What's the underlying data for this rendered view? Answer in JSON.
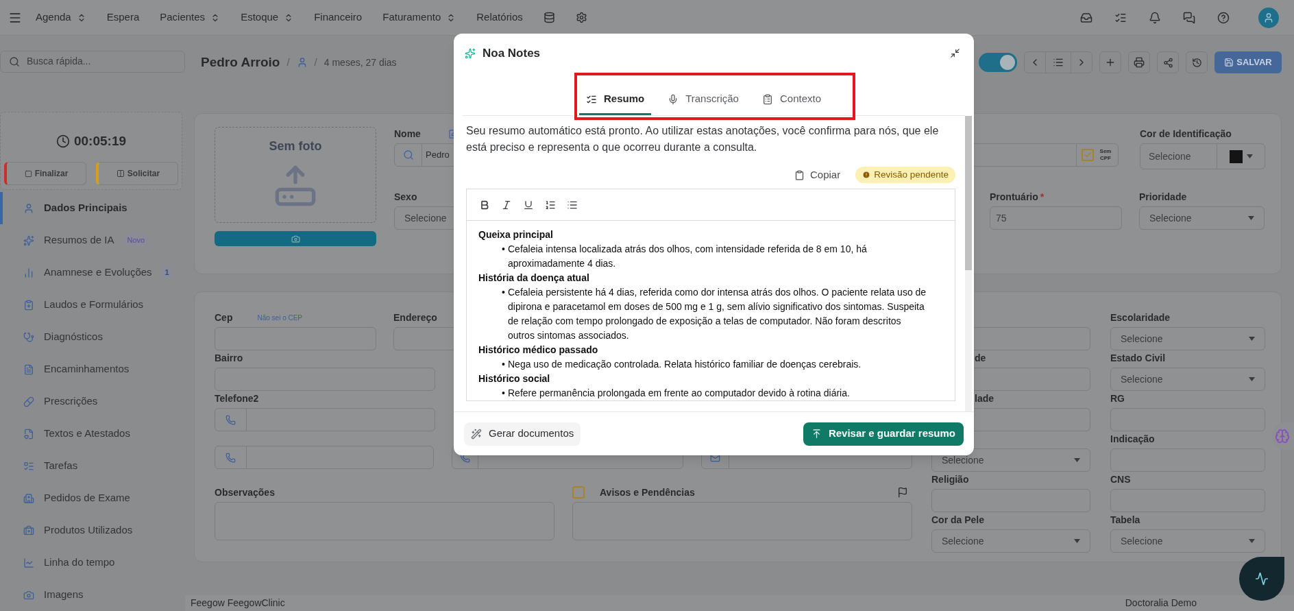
{
  "top_nav": {
    "menu": [
      {
        "label": "Agenda",
        "dropdown": true
      },
      {
        "label": "Espera",
        "dropdown": false
      },
      {
        "label": "Pacientes",
        "dropdown": true
      },
      {
        "label": "Estoque",
        "dropdown": true
      },
      {
        "label": "Financeiro",
        "dropdown": false
      },
      {
        "label": "Faturamento",
        "dropdown": true
      },
      {
        "label": "Relatórios",
        "dropdown": false
      }
    ]
  },
  "sidebar": {
    "search": {
      "placeholder": "Busca rápida..."
    },
    "timer": {
      "time": "00:05:19",
      "buttons": [
        {
          "label": "Finalizar",
          "color": "#c9302c"
        },
        {
          "label": "Solicitar",
          "color": "#d4a017"
        }
      ]
    },
    "items": [
      {
        "label": "Dados Principais",
        "selected": true
      },
      {
        "label": "Resumos de IA",
        "selected": false,
        "badge": "Novo"
      },
      {
        "label": "Anamnese e Evoluções",
        "selected": false,
        "badge": "1"
      },
      {
        "label": "Laudos e Formulários",
        "selected": false
      },
      {
        "label": "Diagnósticos",
        "selected": false
      },
      {
        "label": "Encaminhamentos",
        "selected": false
      },
      {
        "label": "Prescrições",
        "selected": false
      },
      {
        "label": "Textos e Atestados",
        "selected": false
      },
      {
        "label": "Tarefas",
        "selected": false
      },
      {
        "label": "Pedidos de Exame",
        "selected": false
      },
      {
        "label": "Produtos Utilizados",
        "selected": false
      },
      {
        "label": "Linha do tempo",
        "selected": false
      },
      {
        "label": "Imagens",
        "selected": false
      }
    ]
  },
  "header": {
    "patient_name": "Pedro Arroio",
    "separator_1": "/",
    "separator_2": "/",
    "age": "4 meses, 27 dias",
    "toggle": {
      "on": true
    },
    "save_button": "SALVAR"
  },
  "profile_card": {
    "photo_caption": "Sem foto",
    "nome": {
      "label": "Nome",
      "value": "Pedro"
    },
    "sem_cpf": {
      "label": "Sem CPF",
      "checked": true
    },
    "cor_identificacao": {
      "label": "Cor de Identificação",
      "value": "Selecione",
      "color": "#141414"
    },
    "sexo": {
      "label": "Sexo",
      "value": "Selecione"
    },
    "prontuario": {
      "label": "Prontuário",
      "required_mark": "*",
      "value": "75"
    },
    "prioridade": {
      "label": "Prioridade",
      "value": "Selecione"
    }
  },
  "address_card": {
    "cep": {
      "label": "Cep",
      "link": "Não sei o CEP"
    },
    "endereco": {
      "label": "Endereço"
    },
    "bairro": {
      "label": "Bairro"
    },
    "telefone2": {
      "label": "Telefone2"
    },
    "observacoes": {
      "label": "Observações"
    },
    "avisos": {
      "label": "Avisos e Pendências",
      "checked": false
    },
    "right_fields": [
      {
        "kind": "input"
      },
      {
        "kind": "select",
        "label": "Escolaridade",
        "value": "Selecione"
      },
      {
        "kind": "input",
        "label": "de",
        "label_cut": true
      },
      {
        "kind": "select",
        "label": "Estado Civil",
        "value": "Selecione"
      },
      {
        "kind": "input",
        "label": "lade",
        "label_cut": true
      },
      {
        "kind": "input",
        "label": "RG"
      },
      {
        "kind": "select",
        "value": "Selecione"
      },
      {
        "kind": "input",
        "label": "Indicação"
      },
      {
        "kind": "input",
        "label": "Religião"
      },
      {
        "kind": "input",
        "label": "CNS"
      },
      {
        "kind": "select",
        "label": "Cor da Pele",
        "value": "Selecione"
      },
      {
        "kind": "select",
        "label": "Tabela",
        "value": "Selecione"
      }
    ]
  },
  "footer": {
    "left": "Feegow FeegowClinic",
    "right": "Doctoralia Demo"
  },
  "modal": {
    "title": "Noa Notes",
    "tabs_highlighted": true,
    "tabs": [
      {
        "label": "Resumo",
        "selected": true
      },
      {
        "label": "Transcrição",
        "selected": false
      },
      {
        "label": "Contexto",
        "selected": false
      }
    ],
    "intro": "Seu resumo automático está pronto. Ao utilizar estas anotações, você confirma para nós, que ele está preciso e representa o que ocorreu durante a consulta.",
    "copy_button": "Copiar",
    "status_badge": "Revisão pendente",
    "editor": {
      "sections": [
        {
          "heading": "Queixa principal",
          "items": [
            {
              "bullet": "•",
              "text": "Cefaleia intensa localizada atrás dos olhos, com intensidade referida de 8 em 10, há aproximadamente 4 dias."
            }
          ]
        },
        {
          "heading": "História da doença atual",
          "items": [
            {
              "bullet": "•",
              "text": "Cefaleia persistente há 4 dias, referida como dor intensa atrás dos olhos. O paciente relata uso de dipirona e paracetamol em doses de 500 mg e 1 g, sem alívio significativo dos sintomas. Suspeita de relação com tempo prolongado de exposição a telas de computador. Não foram descritos outros sintomas associados."
            }
          ]
        },
        {
          "heading": "Histórico médico passado",
          "items": [
            {
              "bullet": "•",
              "text": "Nega uso de medicação controlada. Relata histórico familiar de doenças cerebrais."
            }
          ]
        },
        {
          "heading": "Histórico social",
          "items": [
            {
              "bullet": "•",
              "text": "Refere permanência prolongada em frente ao computador devido à rotina diária."
            }
          ]
        }
      ]
    },
    "footer_buttons": [
      {
        "label": "Gerar documentos",
        "kind": "secondary"
      },
      {
        "label": "Revisar e guardar resumo",
        "kind": "primary"
      }
    ]
  }
}
